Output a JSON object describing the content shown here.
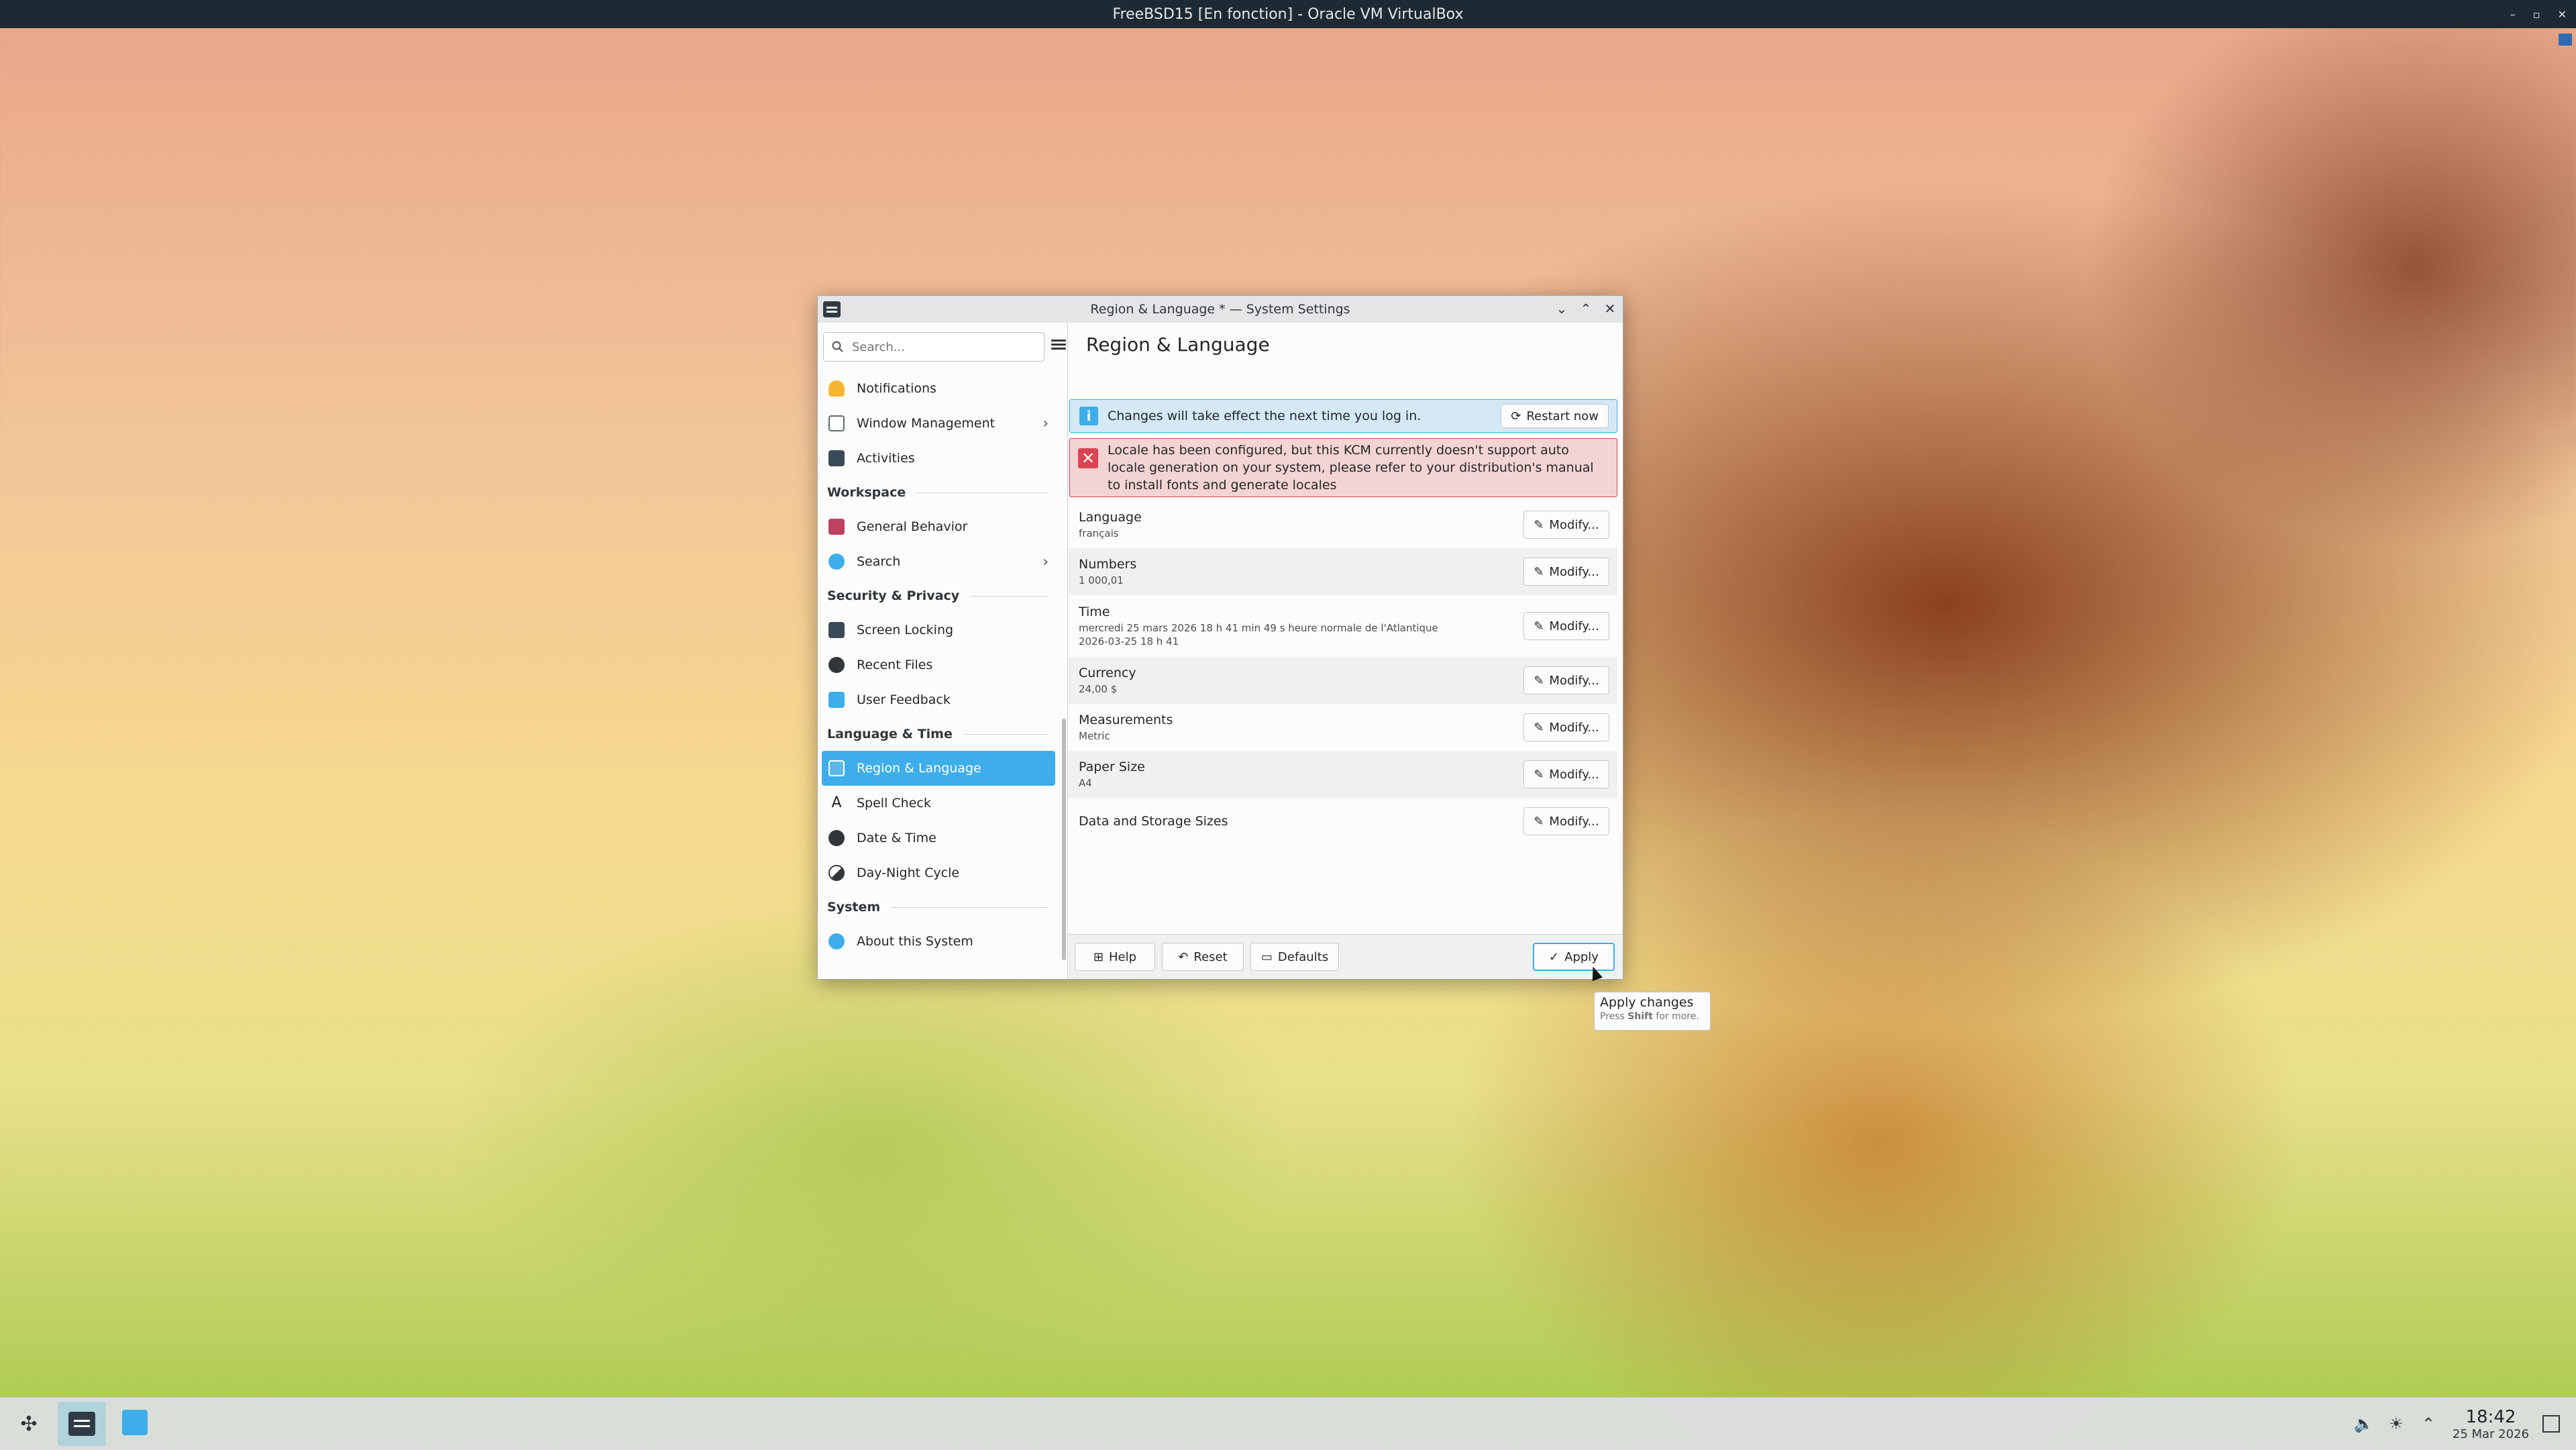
{
  "vbox": {
    "title": "FreeBSD15 [En fonction] - Oracle VM VirtualBox"
  },
  "window": {
    "title": "Region & Language * — System Settings",
    "buttons": {
      "minimize": "⌄",
      "maximize": "⌃",
      "close": "✕"
    }
  },
  "sidebar": {
    "search_placeholder": "Search...",
    "groups": [
      {
        "items": [
          {
            "label": "Notifications",
            "icon": "bell-icon",
            "color": "#f6b634"
          },
          {
            "label": "Window Management",
            "icon": "window-icon",
            "color": "#5f6b74",
            "has_children": true
          },
          {
            "label": "Activities",
            "icon": "activities-icon",
            "color": "#3a4a56"
          }
        ]
      },
      {
        "header": "Workspace",
        "items": [
          {
            "label": "General Behavior",
            "icon": "general-behavior-icon",
            "color": "#c04060"
          },
          {
            "label": "Search",
            "icon": "search-icon",
            "color": "#3daee9",
            "has_children": true
          }
        ]
      },
      {
        "header": "Security & Privacy",
        "items": [
          {
            "label": "Screen Locking",
            "icon": "screen-lock-icon",
            "color": "#3a4a56"
          },
          {
            "label": "Recent Files",
            "icon": "recent-files-icon",
            "color": "#31363b"
          },
          {
            "label": "User Feedback",
            "icon": "feedback-icon",
            "color": "#3daee9"
          }
        ]
      },
      {
        "header": "Language & Time",
        "items": [
          {
            "label": "Region & Language",
            "icon": "region-icon",
            "color": "#5cb9e6",
            "active": true
          },
          {
            "label": "Spell Check",
            "icon": "spell-check-icon",
            "color": "#31363b"
          },
          {
            "label": "Date & Time",
            "icon": "clock-icon",
            "color": "#31363b"
          },
          {
            "label": "Day-Night Cycle",
            "icon": "day-night-icon",
            "color": "#31363b"
          }
        ]
      },
      {
        "header": "System",
        "items": [
          {
            "label": "About this System",
            "icon": "info-icon",
            "color": "#3daee9"
          }
        ]
      }
    ]
  },
  "main": {
    "title": "Region & Language",
    "info_banner": {
      "text": "Changes will take effect the next time you log in.",
      "button": "Restart now"
    },
    "error_banner": {
      "text": "Locale has been configured, but this KCM currently doesn't support auto locale generation on your system, please refer to your distribution's manual to install fonts and generate locales"
    },
    "modify_label": "Modify...",
    "settings": [
      {
        "label": "Language",
        "value": "français"
      },
      {
        "label": "Numbers",
        "value": "1 000,01"
      },
      {
        "label": "Time",
        "value": "mercredi 25 mars 2026 18 h 41 min 49 s heure normale de l'Atlantique",
        "value2": "2026-03-25 18 h 41"
      },
      {
        "label": "Currency",
        "value": "24,00 $"
      },
      {
        "label": "Measurements",
        "value": "Metric"
      },
      {
        "label": "Paper Size",
        "value": "A4"
      },
      {
        "label": "Data and Storage Sizes",
        "value": ""
      }
    ],
    "footer": {
      "help": "Help",
      "reset": "Reset",
      "defaults": "Defaults",
      "apply": "Apply"
    }
  },
  "tooltip": {
    "title": "Apply changes",
    "hint_prefix": "Press ",
    "hint_key": "Shift",
    "hint_suffix": " for more."
  },
  "taskbar": {
    "time": "18:42",
    "date": "25 Mar 2026"
  },
  "colors": {
    "accent": "#3daee9",
    "error": "#da4453"
  }
}
